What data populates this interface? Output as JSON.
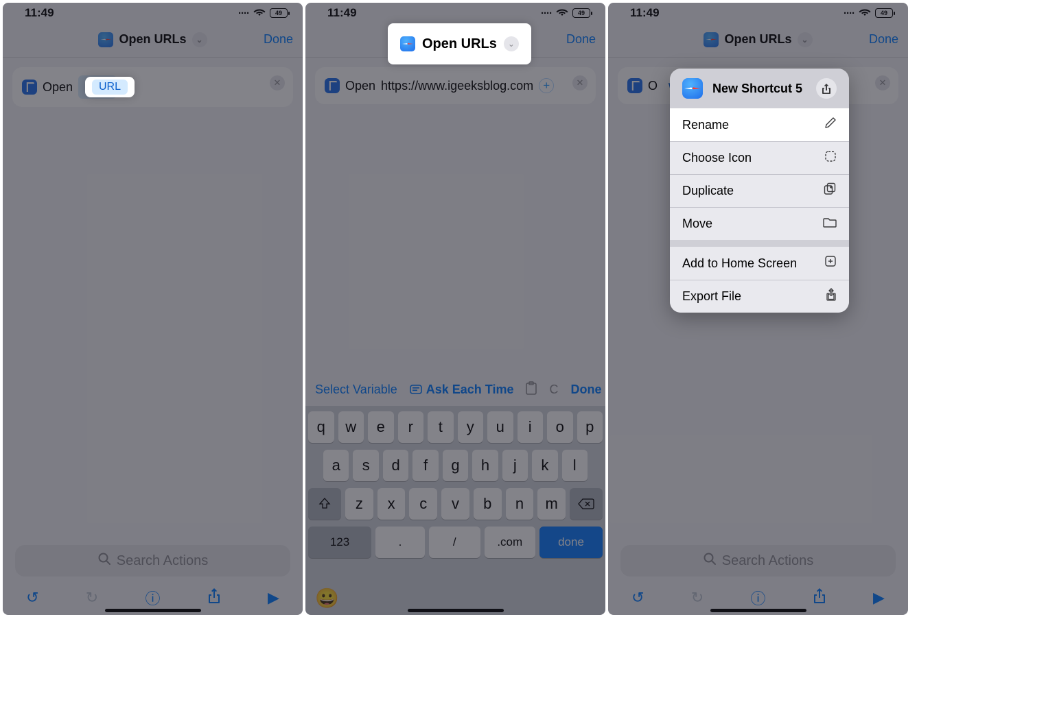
{
  "status": {
    "time": "11:49",
    "battery": "49"
  },
  "nav": {
    "title": "Open URLs",
    "done": "Done"
  },
  "screen1": {
    "open_label": "Open",
    "url_token": "URL",
    "search_placeholder": "Search Actions"
  },
  "screen2": {
    "open_label": "Open",
    "url_value": "https://www.igeeksblog.com",
    "toolbar": {
      "select_variable": "Select Variable",
      "ask_each_time": "Ask Each Time",
      "done": "Done"
    },
    "keyboard": {
      "row1": [
        "q",
        "w",
        "e",
        "r",
        "t",
        "y",
        "u",
        "i",
        "o",
        "p"
      ],
      "row2": [
        "a",
        "s",
        "d",
        "f",
        "g",
        "h",
        "j",
        "k",
        "l"
      ],
      "row3": [
        "z",
        "x",
        "c",
        "v",
        "b",
        "n",
        "m"
      ],
      "num": "123",
      "period": ".",
      "slash": "/",
      "com": ".com",
      "go": "done"
    }
  },
  "screen3": {
    "shortcut_name": "New Shortcut 5",
    "visible_url_fragment": "www.i",
    "visible_open_fragment": "O",
    "menu": {
      "rename": "Rename",
      "choose_icon": "Choose Icon",
      "duplicate": "Duplicate",
      "move": "Move",
      "add_home": "Add to Home Screen",
      "export": "Export File"
    },
    "search_placeholder": "Search Actions"
  }
}
